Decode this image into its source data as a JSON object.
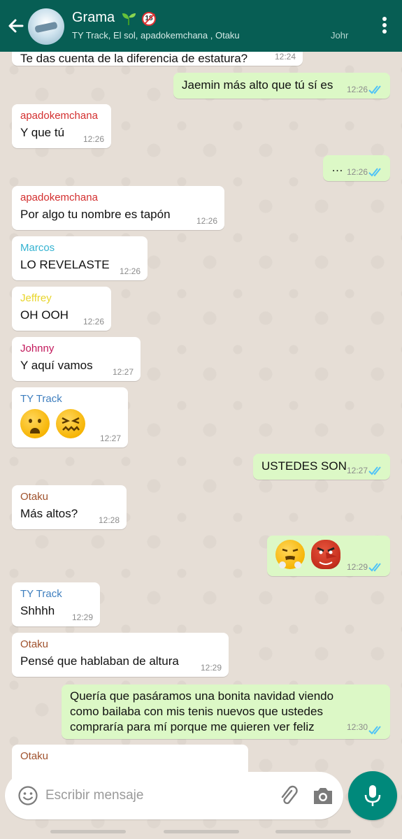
{
  "header": {
    "title": "Grama",
    "subtitle": "TY Track, El sol, apadokemchana , Otaku",
    "subtitle_trail": "Johr",
    "badge": "18",
    "colors": {
      "bar": "#075e54",
      "accent": "#00897b"
    }
  },
  "messages": [
    {
      "dir": "in",
      "text": "Te das cuenta de la diferencia de estatura?",
      "time": "12:24"
    },
    {
      "dir": "out",
      "text": "Jaemin más alto que tú sí es",
      "time": "12:26",
      "status": "read"
    },
    {
      "dir": "in",
      "sender": "apadokemchana",
      "sender_color": "#d32f2f",
      "text": "Y que tú",
      "time": "12:26"
    },
    {
      "dir": "out",
      "text": "…",
      "time": "12:26",
      "status": "read"
    },
    {
      "dir": "in",
      "sender": "apadokemchana",
      "sender_color": "#d32f2f",
      "text": "Por algo tu nombre es tapón",
      "time": "12:26"
    },
    {
      "dir": "in",
      "sender": "Marcos",
      "sender_color": "#35b3d1",
      "text": "LO REVELASTE",
      "time": "12:26"
    },
    {
      "dir": "in",
      "sender": "Jeffrey",
      "sender_color": "#e8d52b",
      "text": "OH OOH",
      "time": "12:26"
    },
    {
      "dir": "in",
      "sender": "Johnny",
      "sender_color": "#c2185b",
      "text": "Y aquí vamos",
      "time": "12:27"
    },
    {
      "dir": "in",
      "sender": "TY Track",
      "sender_color": "#3f7fbf",
      "emojis": [
        "frowning-face",
        "confounded-face"
      ],
      "time": "12:27"
    },
    {
      "dir": "out",
      "text": "USTEDES SON",
      "time": "12:27",
      "status": "read"
    },
    {
      "dir": "in",
      "sender": "Otaku",
      "sender_color": "#a0522d",
      "text": "Más altos?",
      "time": "12:28"
    },
    {
      "dir": "out",
      "emojis": [
        "steam-nose-face",
        "tengu-mask"
      ],
      "time": "12:29",
      "status": "read"
    },
    {
      "dir": "in",
      "sender": "TY Track",
      "sender_color": "#3f7fbf",
      "text": "Shhhh",
      "time": "12:29"
    },
    {
      "dir": "in",
      "sender": "Otaku",
      "sender_color": "#a0522d",
      "text": "Pensé que hablaban de altura",
      "time": "12:29"
    },
    {
      "dir": "out",
      "lines": [
        "Quería que pasáramos una bonita navidad viendo",
        "como bailaba con mis tenis nuevos que ustedes",
        "compraría para mí porque me quieren ver feliz"
      ],
      "time": "12:30",
      "status": "read"
    },
    {
      "dir": "in",
      "sender": "Otaku",
      "sender_color": "#a0522d",
      "text": "",
      "time": ""
    }
  ],
  "composer": {
    "placeholder": "Escribir mensaje",
    "emoji_icon": "smiley-icon",
    "attach_icon": "paperclip-icon",
    "camera_icon": "camera-icon",
    "mic_icon": "microphone-icon"
  },
  "colors": {
    "incoming_bubble": "#ffffff",
    "outgoing_bubble": "#dcf8c6",
    "read_ticks": "#4fc3f7"
  }
}
